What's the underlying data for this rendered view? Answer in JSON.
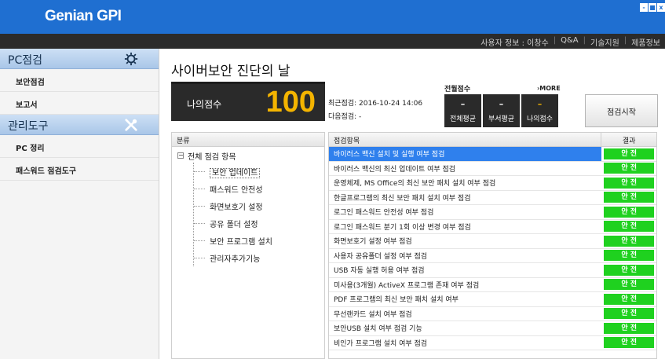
{
  "app": {
    "title": "Genian GPI"
  },
  "window_controls": [
    "-",
    "■",
    "x"
  ],
  "top_nav": {
    "user_info": "사용자 정보 : 이창수",
    "qa": "Q&A",
    "support": "기술지원",
    "product": "제품정보"
  },
  "sidebar": {
    "sections": [
      {
        "title": "PC점검",
        "icon": "gear-icon",
        "items": [
          "보안점검",
          "보고서"
        ]
      },
      {
        "title": "관리도구",
        "icon": "tools-icon",
        "items": [
          "PC 정리",
          "패스워드 점검도구"
        ]
      }
    ]
  },
  "main": {
    "title": "사이버보안 진단의 날",
    "score": {
      "label": "나의점수",
      "value": "100"
    },
    "dates": {
      "recent": "최근점검: 2016-10-24 14:06",
      "next": "다음점검: -"
    },
    "overall": {
      "title": "전월점수",
      "more": "›MORE",
      "stats": [
        {
          "value": "–",
          "label": "전체평균",
          "highlight": false
        },
        {
          "value": "–",
          "label": "부서평균",
          "highlight": false
        },
        {
          "value": "–",
          "label": "나의점수",
          "highlight": true
        }
      ]
    },
    "start_button": "점검시작",
    "tree": {
      "header": "분류",
      "root": "전체 점검 항목",
      "children": [
        "보안 업데이트",
        "패스워드 안전성",
        "화면보호기 설정",
        "공유 폴더 설정",
        "보안 프로그램 설치",
        "관리자추가기능"
      ]
    },
    "table": {
      "headers": [
        "점검항목",
        "결과"
      ],
      "rows": [
        {
          "item": "바이러스 백신 설치 및 실행 여부 점검",
          "result": "안 전"
        },
        {
          "item": "바이러스 백신의 최신 업데이트 여부 점검",
          "result": "안 전"
        },
        {
          "item": "운영체제, MS Office의 최신 보안 패치 설치 여부 점검",
          "result": "안 전"
        },
        {
          "item": "한글프로그램의 최신 보안 패치 설치 여부 점검",
          "result": "안 전"
        },
        {
          "item": "로그인 패스워드 안전성 여부 점검",
          "result": "안 전"
        },
        {
          "item": "로그인 패스워드 분기 1회 이상 변경 여부 점검",
          "result": "안 전"
        },
        {
          "item": "화면보호기 설정 여부 점검",
          "result": "안 전"
        },
        {
          "item": "사용자 공유폴더 설정 여부 점검",
          "result": "안 전"
        },
        {
          "item": "USB 자동 실행 허용 여부 점검",
          "result": "안 전"
        },
        {
          "item": "미사용(3개월) ActiveX 프로그램 존재 여부 점검",
          "result": "안 전"
        },
        {
          "item": "PDF 프로그램의 최신 보안 패치 설치 여부",
          "result": "안 전"
        },
        {
          "item": "무선랜카드 설치 여부 점검",
          "result": "안 전"
        },
        {
          "item": "보안USB 설치 여부 점검 기능",
          "result": "안 전"
        },
        {
          "item": "비인가 프로그램 설치 여부 점검",
          "result": "안 전"
        }
      ]
    }
  },
  "colors": {
    "titlebar": "#1f6fd1",
    "score": "#f4b400",
    "badge": "#1fd11f",
    "selection": "#2f80ed"
  }
}
